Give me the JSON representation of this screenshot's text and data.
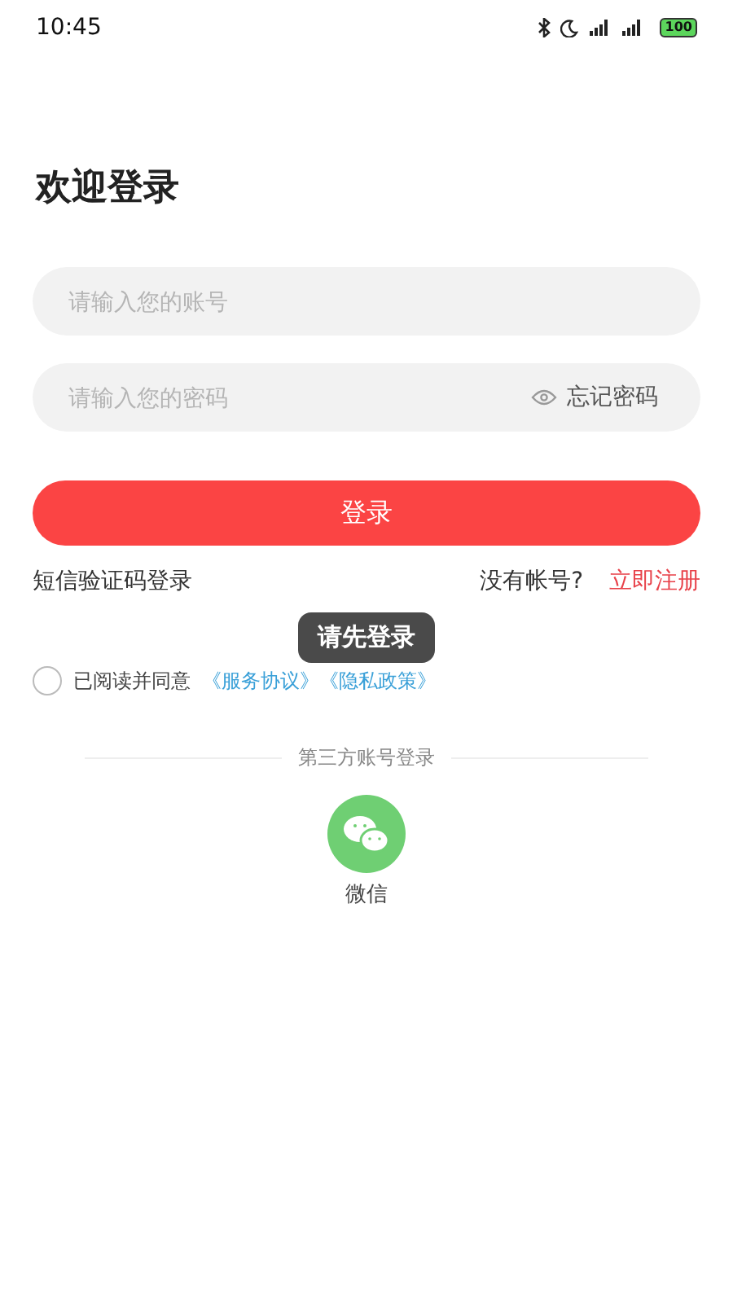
{
  "status_bar": {
    "time": "10:45",
    "battery": "100"
  },
  "title": "欢迎登录",
  "account_field": {
    "placeholder": "请输入您的账号"
  },
  "password_field": {
    "placeholder": "请输入您的密码",
    "forgot": "忘记密码"
  },
  "login_button": "登录",
  "sms_login": "短信验证码登录",
  "no_account": "没有帐号?",
  "register": "立即注册",
  "toast": "请先登录",
  "agreement": {
    "checked": false,
    "text": "已阅读并同意",
    "links": [
      "《服务协议》",
      "《隐私政策》"
    ]
  },
  "third_party": {
    "heading": "第三方账号登录",
    "providers": [
      {
        "kind": "wechat",
        "label": "微信"
      }
    ]
  }
}
